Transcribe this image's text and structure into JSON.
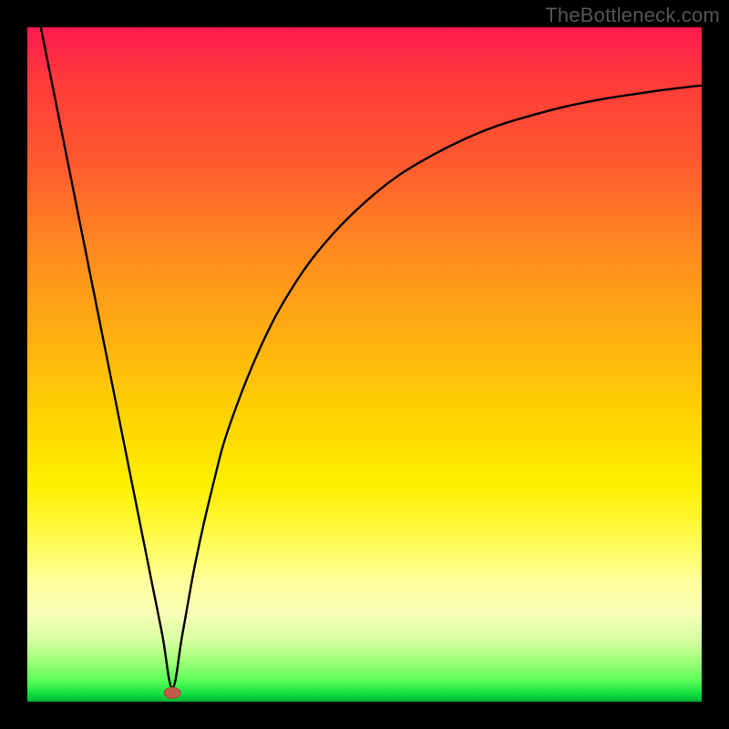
{
  "watermark": "TheBottleneck.com",
  "chart_data": {
    "type": "line",
    "title": "",
    "xlabel": "",
    "ylabel": "",
    "xlim": [
      0,
      100
    ],
    "ylim": [
      0,
      100
    ],
    "x": [
      2,
      4,
      6,
      8,
      10,
      12,
      14,
      16,
      18,
      20,
      21.5,
      23,
      25,
      27.5,
      30,
      35,
      40,
      45,
      50,
      55,
      60,
      65,
      70,
      75,
      80,
      85,
      90,
      95,
      100
    ],
    "values": [
      100,
      90,
      80,
      70,
      60,
      50,
      40,
      30,
      20,
      10,
      2,
      10,
      21,
      32,
      41,
      53.5,
      62.5,
      69,
      74,
      78,
      81,
      83.5,
      85.5,
      87,
      88.3,
      89.3,
      90.1,
      90.8,
      91.4
    ],
    "gradient_colors": {
      "top": "#ff1a4f",
      "mid_upper": "#ff8a1f",
      "mid": "#ffd400",
      "mid_lower": "#fffb52",
      "bottom": "#00b433"
    },
    "marker": {
      "x": 21.5,
      "y": 1.3,
      "color": "#c15a4a"
    }
  }
}
